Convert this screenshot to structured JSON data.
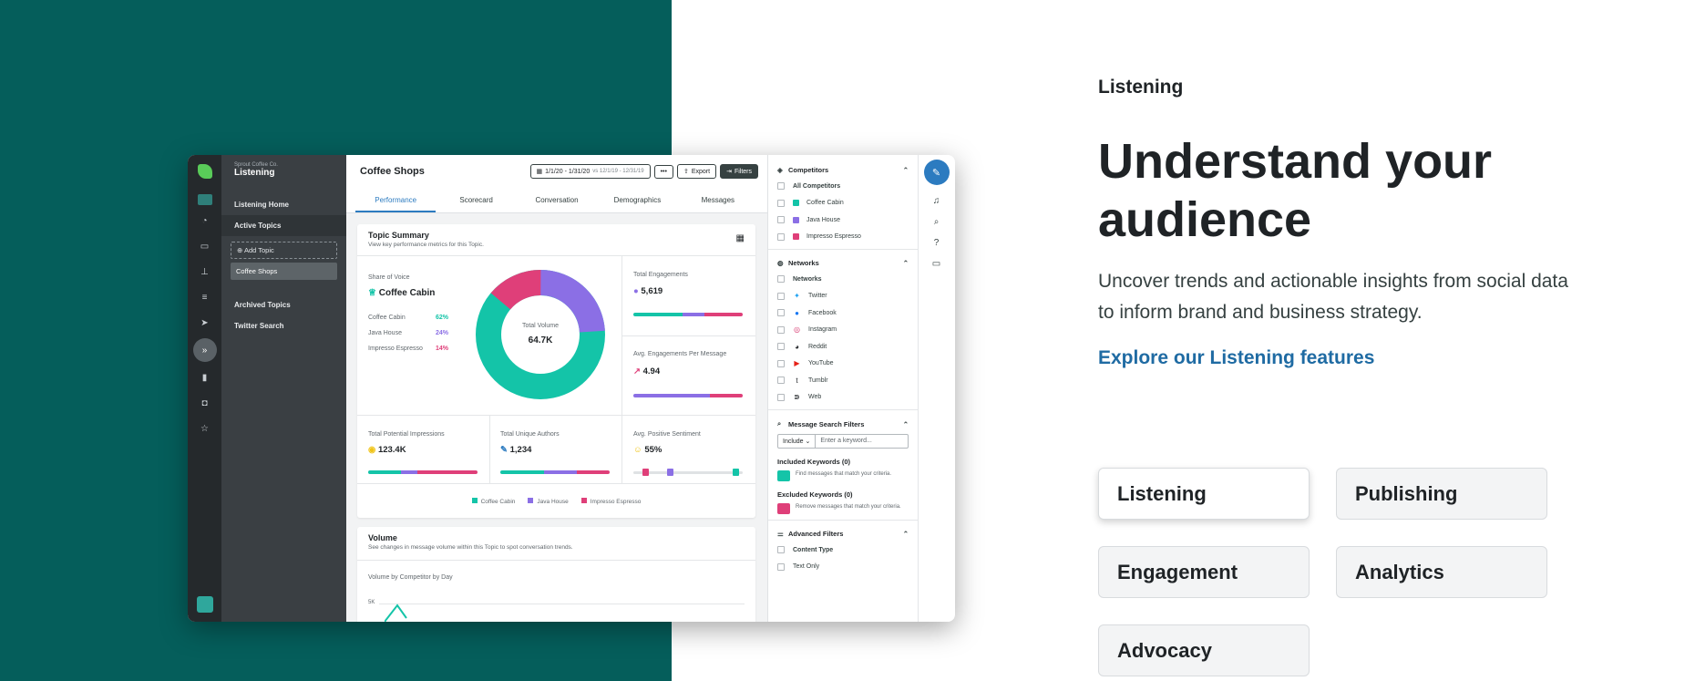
{
  "app": {
    "org": "Sprout Coffee Co.",
    "section": "Listening",
    "nav": {
      "listening_home": "Listening Home",
      "active_topics": "Active Topics",
      "add_topic": "Add Topic",
      "topic": "Coffee Shops",
      "archived": "Archived Topics",
      "twitter_search": "Twitter Search"
    },
    "header": {
      "title": "Coffee Shops",
      "date_range": "1/1/20 - 1/31/20",
      "compare": "vs 12/1/19 - 12/31/19",
      "more": "•••",
      "export": "Export",
      "filters": "Filters"
    },
    "tabs": [
      "Performance",
      "Scorecard",
      "Conversation",
      "Demographics",
      "Messages"
    ],
    "summary": {
      "title": "Topic Summary",
      "subtitle": "View key performance metrics for this Topic.",
      "sov_label": "Share of Voice",
      "sov_leader": "Coffee Cabin",
      "competitors": [
        {
          "name": "Coffee Cabin",
          "pct": "62%",
          "color": "#14c4a8"
        },
        {
          "name": "Java House",
          "pct": "24%",
          "color": "#8b6fe5"
        },
        {
          "name": "Impresso Espresso",
          "pct": "14%",
          "color": "#df3f79"
        }
      ],
      "donut_label": "Total Volume",
      "donut_value": "64.7K",
      "total_engagements_label": "Total Engagements",
      "total_engagements": "5,619",
      "avg_eng_label": "Avg. Engagements Per Message",
      "avg_eng": "4.94",
      "impressions_label": "Total Potential Impressions",
      "impressions": "123.4K",
      "authors_label": "Total Unique Authors",
      "authors": "1,234",
      "sentiment_label": "Avg. Positive Sentiment",
      "sentiment": "55%"
    },
    "volume": {
      "title": "Volume",
      "subtitle": "See changes in message volume within this Topic to spot conversation trends.",
      "chart_label": "Volume by Competitor by Day",
      "tick": "5K"
    },
    "filters": {
      "competitors_title": "Competitors",
      "all_competitors": "All Competitors",
      "competitors": [
        "Coffee Cabin",
        "Java House",
        "Impresso Espresso"
      ],
      "networks_title": "Networks",
      "networks_all": "Networks",
      "networks": [
        "Twitter",
        "Facebook",
        "Instagram",
        "Reddit",
        "YouTube",
        "Tumblr",
        "Web"
      ],
      "message_search": "Message Search Filters",
      "include": "Include",
      "keyword_placeholder": "Enter a keyword...",
      "included_kw": "Included Keywords (0)",
      "included_hint": "Find messages that match your criteria.",
      "excluded_kw": "Excluded Keywords (0)",
      "excluded_hint": "Remove messages that match your criteria.",
      "advanced": "Advanced Filters",
      "content_type": "Content Type",
      "text_only": "Text Only"
    }
  },
  "copy": {
    "eyebrow": "Listening",
    "headline": "Understand your audience",
    "description": "Uncover trends and actionable insights from social data to inform brand and business strategy.",
    "link": "Explore our Listening features"
  },
  "features": [
    "Listening",
    "Publishing",
    "Engagement",
    "Analytics",
    "Advocacy"
  ],
  "colors": {
    "teal": "#055e5b",
    "link": "#1f6ba3",
    "accent_blue": "#2c7bc0"
  }
}
